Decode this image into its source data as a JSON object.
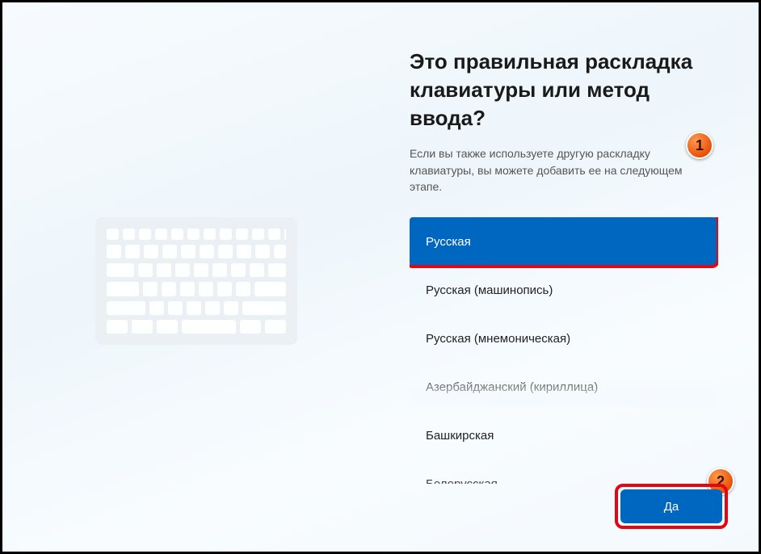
{
  "heading": "Это правильная раскладка клавиатуры или метод ввода?",
  "subtext": "Если вы также используете другую раскладку клавиатуры, вы можете добавить ее на следующем этапе.",
  "layouts": {
    "items": [
      "Русская",
      "Русская (машинопись)",
      "Русская (мнемоническая)",
      "Азербайджанский (кириллица)",
      "Башкирская",
      "Белорусская"
    ],
    "selected_index": 0
  },
  "yes_button": "Да",
  "callouts": {
    "one": "1",
    "two": "2"
  }
}
